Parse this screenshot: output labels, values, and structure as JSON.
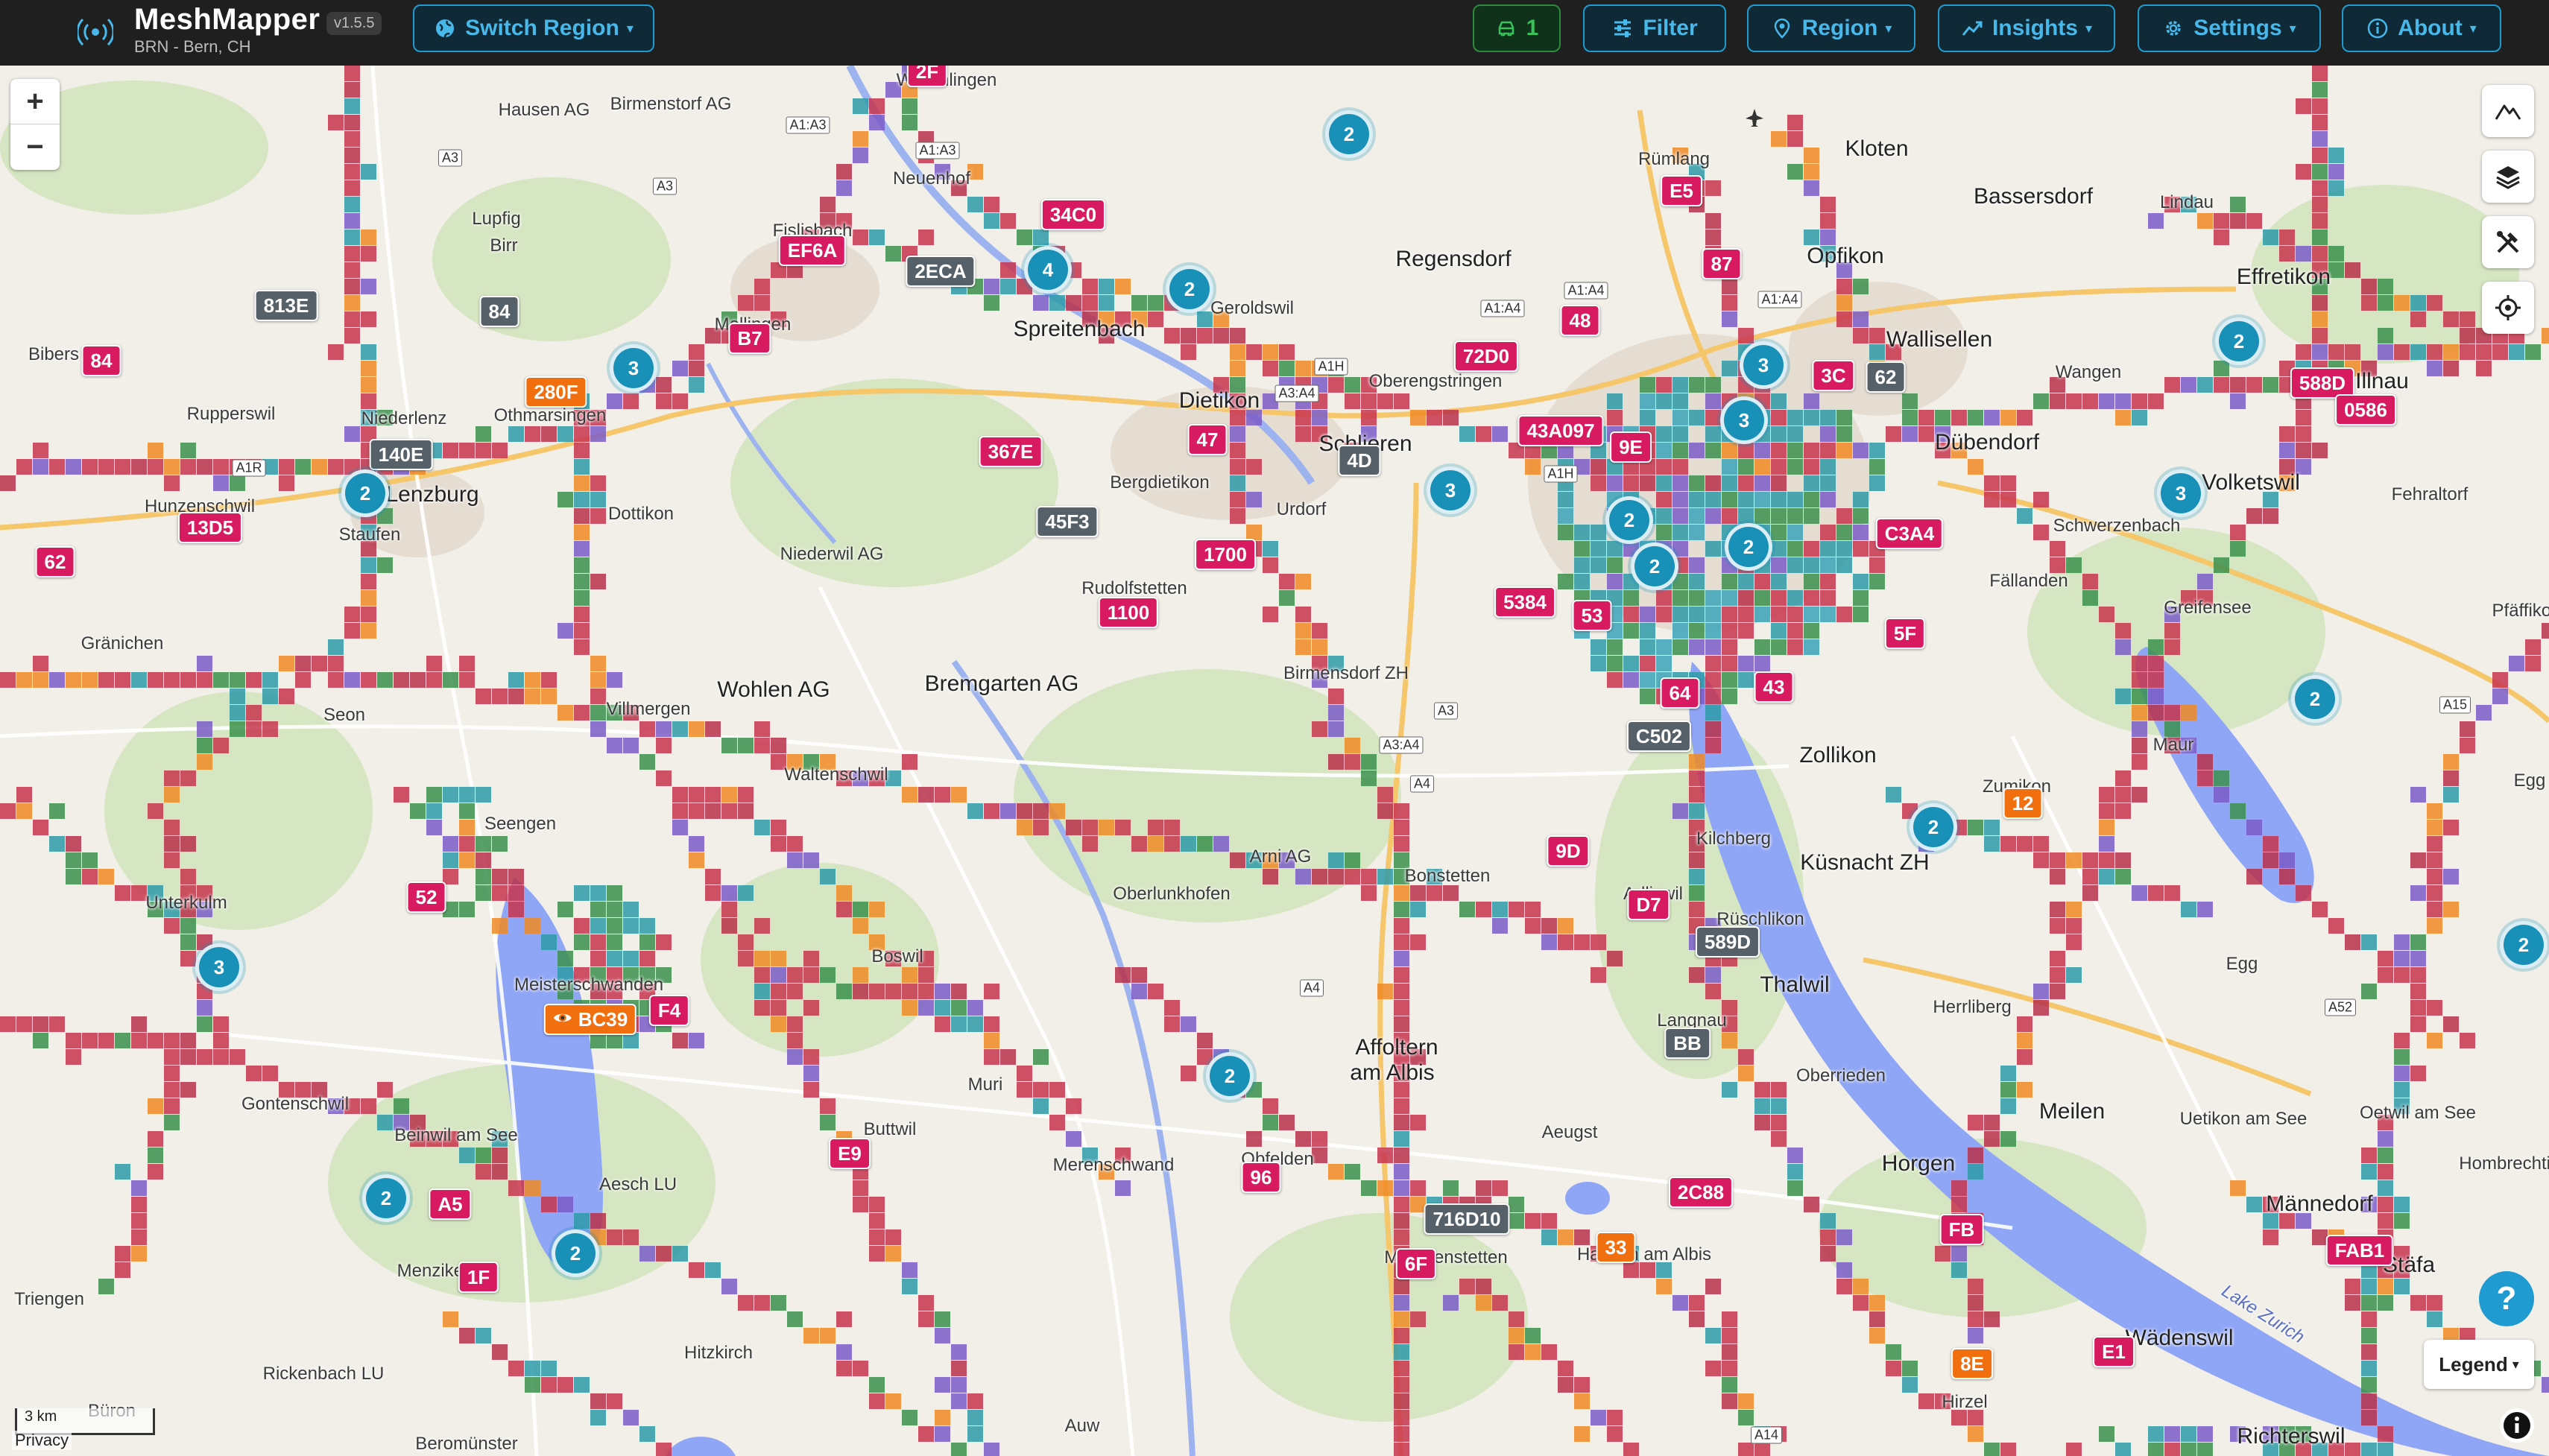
{
  "app": {
    "title": "MeshMapper",
    "version": "v1.5.5",
    "subtitle": "BRN - Bern, CH"
  },
  "toolbar": {
    "switch_region": "Switch Region",
    "devices_count": "1",
    "filter": "Filter",
    "region": "Region",
    "insights": "Insights",
    "settings": "Settings",
    "about": "About",
    "caret": "▾"
  },
  "colors": {
    "accent": "#1f9bd1",
    "node_tag": "#d81b60",
    "gray_tag": "#566069",
    "orange_tag": "#f26f0f",
    "cluster": "#1990b8",
    "water": "#8fa5f5"
  },
  "map": {
    "zoom_in": "+",
    "zoom_out": "−",
    "scale": "3 km",
    "privacy": "Privacy",
    "legend": "Legend",
    "help": "?",
    "node_tags": [
      {
        "label": "2F"
      },
      {
        "label": "34C0"
      },
      {
        "label": "EF6A"
      },
      {
        "label": "2ECA"
      },
      {
        "label": "813E"
      },
      {
        "label": "84"
      },
      {
        "label": "84"
      },
      {
        "label": "280F"
      },
      {
        "label": "B7"
      },
      {
        "label": "140E"
      },
      {
        "label": "13D5"
      },
      {
        "label": "62"
      },
      {
        "label": "367E"
      },
      {
        "label": "45F3"
      },
      {
        "label": "47"
      },
      {
        "label": "4D"
      },
      {
        "label": "72D0"
      },
      {
        "label": "48"
      },
      {
        "label": "E5"
      },
      {
        "label": "87"
      },
      {
        "label": "43A097"
      },
      {
        "label": "9E"
      },
      {
        "label": "1700"
      },
      {
        "label": "1100"
      },
      {
        "label": "5384"
      },
      {
        "label": "53"
      },
      {
        "label": "3C"
      },
      {
        "label": "62"
      },
      {
        "label": "C3A4"
      },
      {
        "label": "5F"
      },
      {
        "label": "64"
      },
      {
        "label": "43"
      },
      {
        "label": "C502"
      },
      {
        "label": "9D"
      },
      {
        "label": "D7"
      },
      {
        "label": "589D"
      },
      {
        "label": "BB"
      },
      {
        "label": "12"
      },
      {
        "label": "588D"
      },
      {
        "label": "0586"
      },
      {
        "label": "52"
      },
      {
        "label": "BC39"
      },
      {
        "label": "F4"
      },
      {
        "label": "E9"
      },
      {
        "label": "A5"
      },
      {
        "label": "1F"
      },
      {
        "label": "96"
      },
      {
        "label": "716D10"
      },
      {
        "label": "6F"
      },
      {
        "label": "33"
      },
      {
        "label": "2C88"
      },
      {
        "label": "FB"
      },
      {
        "label": "FAB1"
      },
      {
        "label": "8E"
      },
      {
        "label": "E1"
      }
    ],
    "clusters": [
      {
        "count": "2"
      },
      {
        "count": "4"
      },
      {
        "count": "2"
      },
      {
        "count": "3"
      },
      {
        "count": "2"
      },
      {
        "count": "3"
      },
      {
        "count": "3"
      },
      {
        "count": "3"
      },
      {
        "count": "2"
      },
      {
        "count": "2"
      },
      {
        "count": "2"
      },
      {
        "count": "2"
      },
      {
        "count": "3"
      },
      {
        "count": "2"
      },
      {
        "count": "2"
      },
      {
        "count": "3"
      },
      {
        "count": "2"
      },
      {
        "count": "2"
      },
      {
        "count": "2"
      },
      {
        "count": "2"
      }
    ],
    "places": [
      "Würenlingen",
      "Hausen AG",
      "Birmenstorf AG",
      "Lupfig",
      "Birr",
      "Neuenhof",
      "Fislisbach",
      "Mellingen",
      "Bibers",
      "Niederlenz",
      "Othmarsingen",
      "Rupperswil",
      "Hunzenschwil",
      "Lenzburg",
      "Staufen",
      "Dottikon",
      "Niederwil AG",
      "Spreitenbach",
      "Geroldswil",
      "Dietikon",
      "Oberengstringen",
      "Schlieren",
      "Bergdietikon",
      "Urdorf",
      "Rudolfstetten",
      "Regensdorf",
      "Rümlang",
      "Kloten",
      "Opfikon",
      "Wallisellen",
      "Bassersdorf",
      "Lindau",
      "Effretikon",
      "Wangen",
      "Dübendorf",
      "Volketswil",
      "Fehraltorf",
      "Schwerzenbach",
      "Fällanden",
      "Greifensee",
      "Gränichen",
      "Seon",
      "Villmergen",
      "Wohlen AG",
      "Waltenschwil",
      "Bremgarten AG",
      "Birmensdorf ZH",
      "Zollikon",
      "Maur",
      "Zumikon",
      "Küsnacht ZH",
      "Kilchberg",
      "Adliswil",
      "Rüschlikon",
      "Thalwil",
      "Langnau",
      "Herrliberg",
      "Egg",
      "Oberrieden",
      "Meilen",
      "Uetikon am See",
      "Oetwil am See",
      "Horgen",
      "Männedorf",
      "Stäfa",
      "Wädenswil",
      "Richterswil",
      "Hirzel",
      "Unterkulm",
      "Seengen",
      "Meisterschwanden",
      "Boswil",
      "Muri",
      "Buttwil",
      "Gontenschwil",
      "Beinwil am See",
      "Aesch LU",
      "Menziken",
      "Triengen",
      "Rickenbach LU",
      "Hitzkirch",
      "Beromünster",
      "Büron",
      "Merenschwand",
      "Obfelden",
      "Arni AG",
      "Oberlunkhofen",
      "Bonstetten",
      "Affoltern",
      "am Albis",
      "Mettmenstetten",
      "Hausen am Albis",
      "Aeugst",
      "Auw",
      "Lake Zurich",
      "Hombrechtikon",
      "Pfäffikon",
      "Illnau",
      "Egg"
    ],
    "roads": [
      "A1:A3",
      "A1:A3",
      "A3",
      "A3",
      "A1R",
      "A1:A4",
      "A1:A4",
      "A1:A4",
      "A1H",
      "A3:A4",
      "A1H",
      "A3",
      "A3:A4",
      "A4",
      "A4",
      "A15",
      "A52",
      "A14",
      "A4"
    ]
  }
}
